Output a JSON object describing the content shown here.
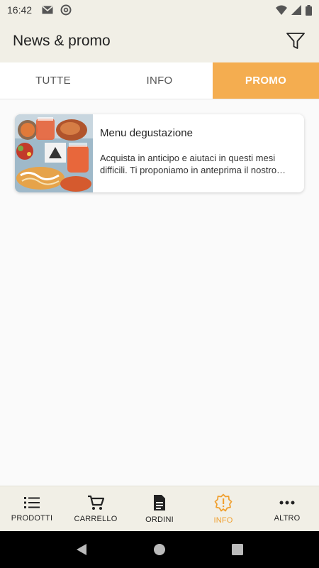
{
  "status_bar": {
    "time": "16:42",
    "left_icons": [
      "gmail-icon",
      "at-sign-icon"
    ],
    "right_icons": [
      "wifi-icon",
      "signal-icon",
      "battery-icon"
    ]
  },
  "app_bar": {
    "title": "News & promo",
    "filter_icon": "filter-icon"
  },
  "tabs": [
    {
      "label": "TUTTE",
      "active": false
    },
    {
      "label": "INFO",
      "active": false
    },
    {
      "label": "PROMO",
      "active": true
    }
  ],
  "cards": [
    {
      "title": "Menu degustazione",
      "description": "Acquista in anticipo e aiutaci in questi mesi difficili. Ti proponiamo in anteprima il nostro menu degustazione",
      "image_icon": "food-photo"
    }
  ],
  "bottom_nav": [
    {
      "label": "PRODOTTI",
      "icon": "list-icon",
      "active": false
    },
    {
      "label": "CARRELLO",
      "icon": "cart-icon",
      "active": false
    },
    {
      "label": "ORDINI",
      "icon": "document-icon",
      "active": false
    },
    {
      "label": "INFO",
      "icon": "info-alert-icon",
      "active": true
    },
    {
      "label": "ALTRO",
      "icon": "more-icon",
      "active": false
    }
  ],
  "colors": {
    "accent": "#f4ad50",
    "nav_active": "#f0a030",
    "bar_background": "#f1efe6"
  }
}
